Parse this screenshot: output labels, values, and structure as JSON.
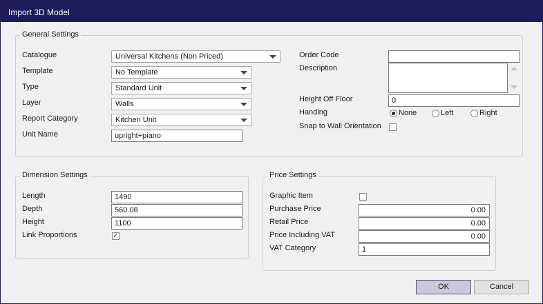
{
  "window": {
    "title": "Import 3D Model"
  },
  "general": {
    "title": "General Settings",
    "catalogue": {
      "label": "Catalogue",
      "value": "Universal Kitchens (Non Priced)"
    },
    "template": {
      "label": "Template",
      "value": "No Template"
    },
    "type": {
      "label": "Type",
      "value": "Standard Unit"
    },
    "layer": {
      "label": "Layer",
      "value": "Walls"
    },
    "report_category": {
      "label": "Report Category",
      "value": "Kitchen Unit"
    },
    "unit_name": {
      "label": "Unit Name",
      "value": "upright+piano"
    },
    "order_code": {
      "label": "Order Code",
      "value": ""
    },
    "description": {
      "label": "Description",
      "value": ""
    },
    "height_off_floor": {
      "label": "Height Off Floor",
      "value": "0"
    },
    "handing": {
      "label": "Handing",
      "options": [
        "None",
        "Left",
        "Right"
      ],
      "selected": "None"
    },
    "snap": {
      "label": "Snap to Wall Orientation",
      "checked": false
    }
  },
  "dimension": {
    "title": "Dimension Settings",
    "length": {
      "label": "Length",
      "value": "1490"
    },
    "depth": {
      "label": "Depth",
      "value": "560.08"
    },
    "height": {
      "label": "Height",
      "value": "1100"
    },
    "link": {
      "label": "Link Proportions",
      "checked": true,
      "mark": "✓"
    }
  },
  "price": {
    "title": "Price Settings",
    "graphic_item": {
      "label": "Graphic Item",
      "checked": false
    },
    "purchase_price": {
      "label": "Purchase Price",
      "value": "0.00"
    },
    "retail_price": {
      "label": "Retail Price",
      "value": "0.00"
    },
    "price_inc_vat": {
      "label": "Price Including VAT",
      "value": "0.00"
    },
    "vat_category": {
      "label": "VAT Category",
      "value": "1"
    }
  },
  "buttons": {
    "ok": "OK",
    "cancel": "Cancel"
  }
}
